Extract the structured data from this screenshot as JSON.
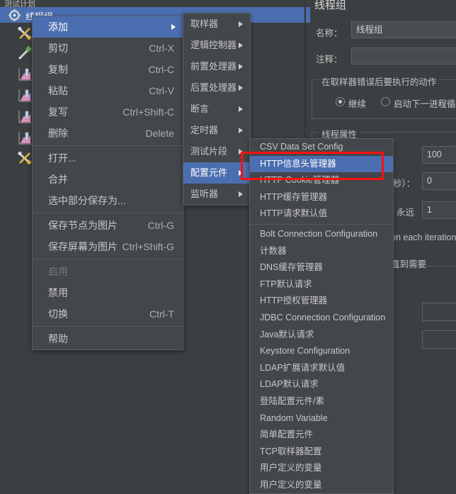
{
  "window": {
    "tree_top_label": "测试计划",
    "selected_node": "线程组",
    "selected_node_icon": "gear-icon"
  },
  "tree_icons": [
    {
      "name": "tools-icon"
    },
    {
      "name": "pipette-icon"
    },
    {
      "name": "chart-icon"
    },
    {
      "name": "chart-icon"
    },
    {
      "name": "chart-icon"
    },
    {
      "name": "chart-icon"
    },
    {
      "name": "tools-icon"
    }
  ],
  "context_menu": {
    "items": [
      {
        "label": "添加",
        "accel": "",
        "submenu": true,
        "selected": true,
        "separator_after": false
      },
      {
        "label": "剪切",
        "accel": "Ctrl-X",
        "submenu": false,
        "selected": false,
        "separator_after": false
      },
      {
        "label": "复制",
        "accel": "Ctrl-C",
        "submenu": false,
        "selected": false,
        "separator_after": false
      },
      {
        "label": "粘贴",
        "accel": "Ctrl-V",
        "submenu": false,
        "selected": false,
        "separator_after": false
      },
      {
        "label": "复写",
        "accel": "Ctrl+Shift-C",
        "submenu": false,
        "selected": false,
        "separator_after": false
      },
      {
        "label": "删除",
        "accel": "Delete",
        "submenu": false,
        "selected": false,
        "separator_after": true
      },
      {
        "label": "打开...",
        "accel": "",
        "submenu": false,
        "selected": false,
        "separator_after": false
      },
      {
        "label": "合并",
        "accel": "",
        "submenu": false,
        "selected": false,
        "separator_after": false
      },
      {
        "label": "选中部分保存为...",
        "accel": "",
        "submenu": false,
        "selected": false,
        "separator_after": true
      },
      {
        "label": "保存节点为图片",
        "accel": "Ctrl-G",
        "submenu": false,
        "selected": false,
        "separator_after": false
      },
      {
        "label": "保存屏幕为图片",
        "accel": "Ctrl+Shift-G",
        "submenu": false,
        "selected": false,
        "separator_after": true
      },
      {
        "label": "启用",
        "accel": "",
        "submenu": false,
        "selected": false,
        "disabled": true,
        "separator_after": false
      },
      {
        "label": "禁用",
        "accel": "",
        "submenu": false,
        "selected": false,
        "separator_after": false
      },
      {
        "label": "切换",
        "accel": "Ctrl-T",
        "submenu": false,
        "selected": false,
        "separator_after": true
      },
      {
        "label": "帮助",
        "accel": "",
        "submenu": false,
        "selected": false,
        "separator_after": false
      }
    ]
  },
  "add_submenu": {
    "items": [
      {
        "label": "取样器",
        "submenu": true,
        "selected": false
      },
      {
        "label": "逻辑控制器",
        "submenu": true,
        "selected": false
      },
      {
        "label": "前置处理器",
        "submenu": true,
        "selected": false
      },
      {
        "label": "后置处理器",
        "submenu": true,
        "selected": false
      },
      {
        "label": "断言",
        "submenu": true,
        "selected": false
      },
      {
        "label": "定时器",
        "submenu": true,
        "selected": false
      },
      {
        "label": "测试片段",
        "submenu": true,
        "selected": false
      },
      {
        "label": "配置元件",
        "submenu": true,
        "selected": true
      },
      {
        "label": "监听器",
        "submenu": true,
        "selected": false
      }
    ]
  },
  "config_submenu": {
    "items": [
      {
        "label": "CSV Data Set Config",
        "selected": false,
        "separator_after": false
      },
      {
        "label": "HTTP信息头管理器",
        "selected": true,
        "separator_after": false
      },
      {
        "label": "HTTP Cookie管理器",
        "selected": false,
        "separator_after": false
      },
      {
        "label": "HTTP缓存管理器",
        "selected": false,
        "separator_after": false
      },
      {
        "label": "HTTP请求默认值",
        "selected": false,
        "separator_after": true
      },
      {
        "label": "Bolt Connection Configuration",
        "selected": false,
        "separator_after": false
      },
      {
        "label": "计数器",
        "selected": false,
        "separator_after": false
      },
      {
        "label": "DNS缓存管理器",
        "selected": false,
        "separator_after": false
      },
      {
        "label": "FTP默认请求",
        "selected": false,
        "separator_after": false
      },
      {
        "label": "HTTP授权管理器",
        "selected": false,
        "separator_after": false
      },
      {
        "label": "JDBC Connection Configuration",
        "selected": false,
        "separator_after": false
      },
      {
        "label": "Java默认请求",
        "selected": false,
        "separator_after": false
      },
      {
        "label": "Keystore Configuration",
        "selected": false,
        "separator_after": false
      },
      {
        "label": "LDAP扩展请求默认值",
        "selected": false,
        "separator_after": false
      },
      {
        "label": "LDAP默认请求",
        "selected": false,
        "separator_after": false
      },
      {
        "label": "登陆配置元件/素",
        "selected": false,
        "separator_after": false
      },
      {
        "label": "Random Variable",
        "selected": false,
        "separator_after": false
      },
      {
        "label": "简单配置元件",
        "selected": false,
        "separator_after": false
      },
      {
        "label": "TCP取样器配置",
        "selected": false,
        "separator_after": false
      },
      {
        "label": "用户定义的变量",
        "selected": false,
        "separator_after": false
      },
      {
        "label": "用户定义的变量",
        "selected": false,
        "separator_after": false
      }
    ]
  },
  "properties": {
    "title": "线程组",
    "name_label": "名称：",
    "name_value": "线程组",
    "comment_label": "注释：",
    "comment_value": "",
    "error_action_group": "在取样器错误后要执行的动作",
    "radio_continue": "继续",
    "radio_next_loop": "启动下一进程循环",
    "thread_props_group": "线程属性",
    "threads_value": "100",
    "rampup_suffix": "秒）：",
    "rampup_value": "0",
    "forever_label": "永远",
    "loop_value": "1",
    "checkbox_iteration": "on each iteration",
    "checkbox_delay": "直到需要",
    "field_a_value": "",
    "field_b_value": ""
  },
  "annotation": {
    "highlight_color": "#ff1111",
    "highlight_target": "HTTP信息头管理器"
  },
  "colors": {
    "menu_bg": "#43464a",
    "panel_bg": "#3c3f41",
    "accent": "#4b6eb0",
    "text": "#c8c8c8"
  }
}
